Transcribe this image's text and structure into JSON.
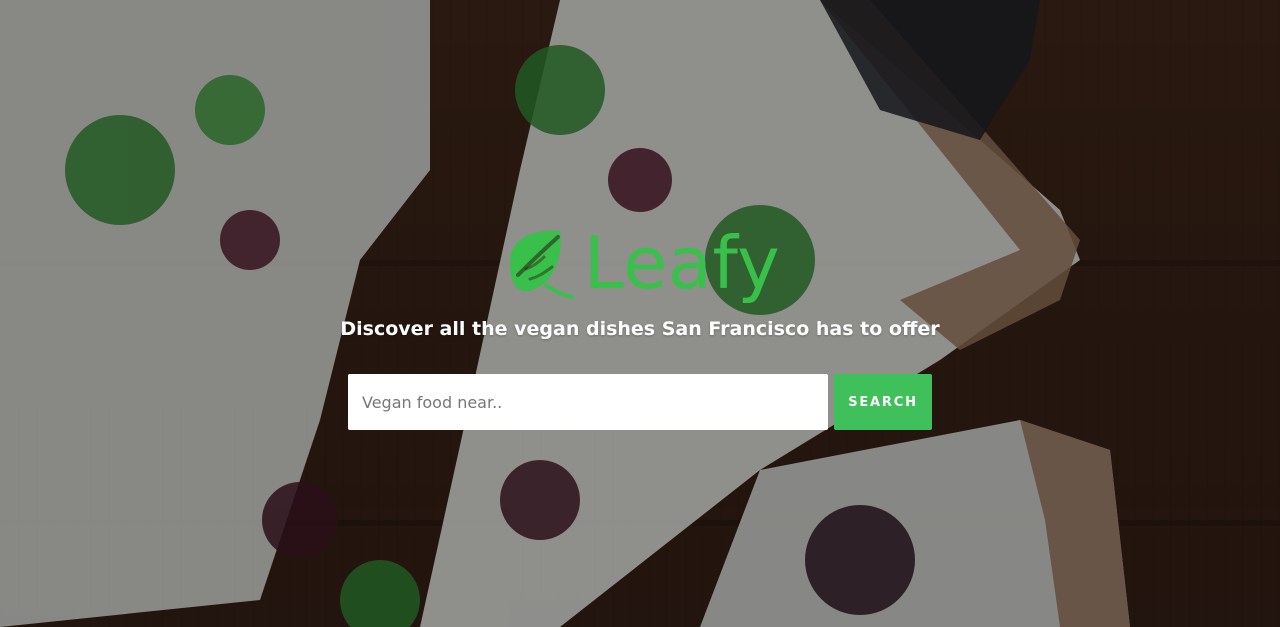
{
  "brand": {
    "name": "Leafy",
    "icon": "leaf-icon",
    "color": "#39c04a"
  },
  "hero": {
    "tagline": "Discover all the vegan dishes San Francisco has to offer"
  },
  "search": {
    "value": "",
    "placeholder": "Vegan food near..",
    "button_label": "SEARCH",
    "button_color": "#3fc05a"
  }
}
